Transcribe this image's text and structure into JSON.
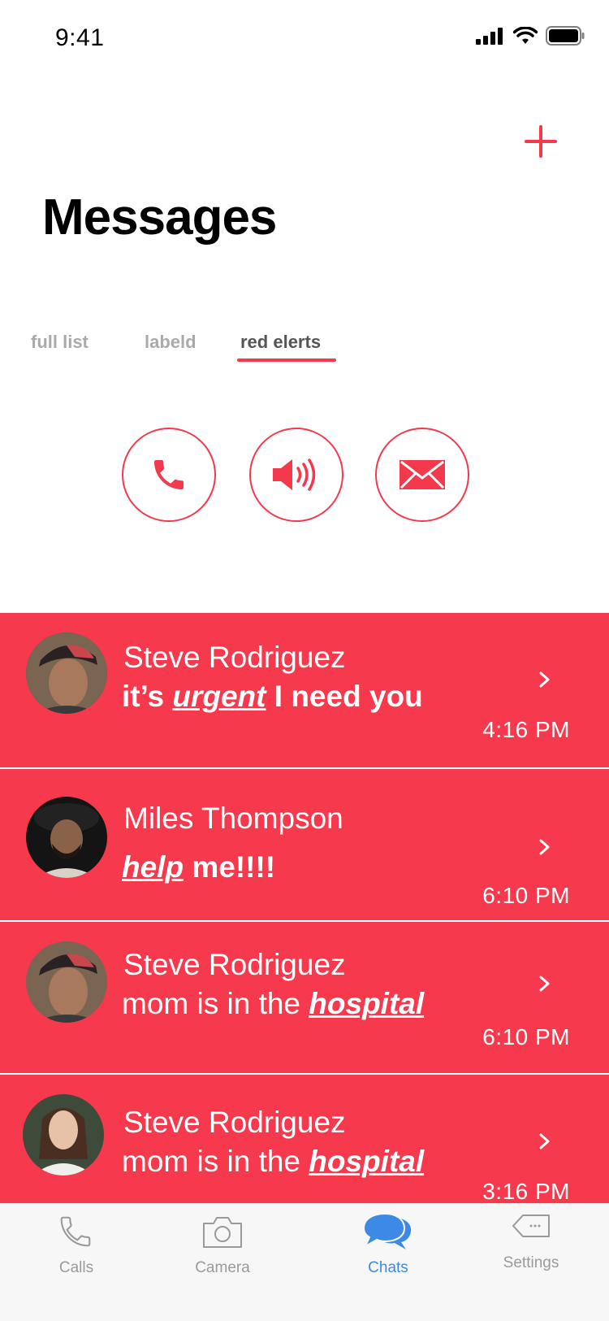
{
  "status_bar": {
    "time": "9:41"
  },
  "header": {
    "title": "Messages"
  },
  "tabs": [
    {
      "label": "full list"
    },
    {
      "label": "labeld"
    },
    {
      "label": "red elerts"
    }
  ],
  "actions": [
    {
      "icon": "phone-icon"
    },
    {
      "icon": "speaker-icon"
    },
    {
      "icon": "mail-icon"
    }
  ],
  "chats": [
    {
      "name": "Steve Rodriguez",
      "msg_before": "it’s ",
      "msg_emph": "urgent",
      "msg_after": " I need you",
      "time": "4:16 PM",
      "bold_message": true
    },
    {
      "name": "Miles Thompson",
      "msg_before": "",
      "msg_emph": "help",
      "msg_after": " me!!!!",
      "time": "6:10 PM",
      "bold_message": true
    },
    {
      "name": "Steve Rodriguez",
      "msg_before": "mom is in the ",
      "msg_emph": "hospital",
      "msg_after": "",
      "time": "6:10 PM",
      "bold_message": false
    },
    {
      "name": "Steve Rodriguez",
      "msg_before": "mom is in the ",
      "msg_emph": "hospital",
      "msg_after": "",
      "time": "3:16 PM",
      "bold_message": false
    }
  ],
  "tab_bar": [
    {
      "label": "Calls",
      "icon": "phone-icon"
    },
    {
      "label": "Camera",
      "icon": "camera-icon"
    },
    {
      "label": "Chats",
      "icon": "chat-bubbles-icon",
      "active": true
    },
    {
      "label": "Settings",
      "icon": "tag-icon"
    }
  ],
  "colors": {
    "accent": "#f5394d",
    "row_bg": "#f6394c",
    "tab_active": "#3c8ae6"
  }
}
